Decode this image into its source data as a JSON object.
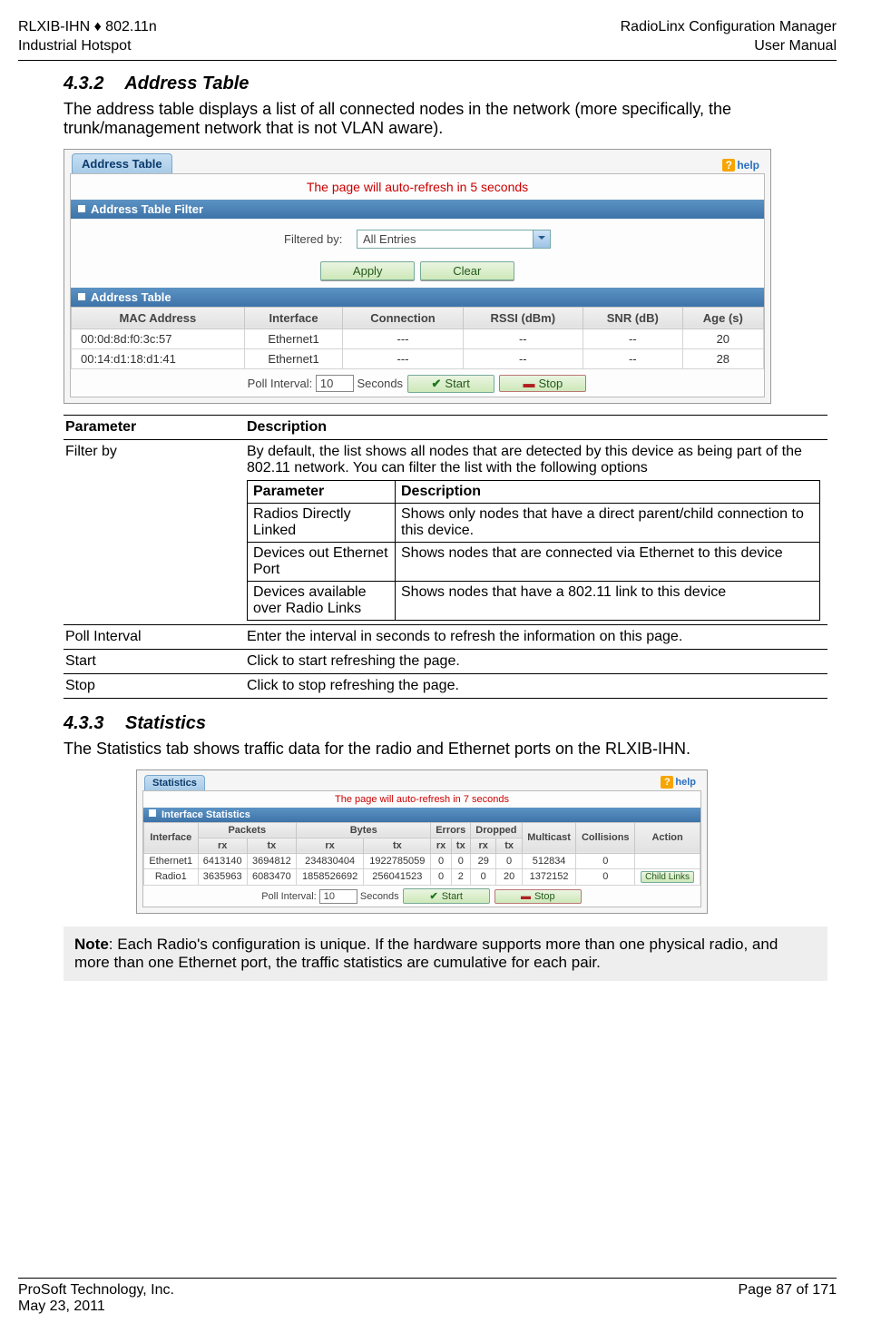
{
  "header": {
    "left_line1": "RLXIB-IHN ♦ 802.11n",
    "left_line2": "Industrial Hotspot",
    "right_line1": "RadioLinx Configuration Manager",
    "right_line2": "User Manual"
  },
  "sec1": {
    "num": "4.3.2",
    "title": "Address Table",
    "intro": "The address table displays a list of all connected nodes in the network (more specifically, the trunk/management network that is not VLAN aware)."
  },
  "addr_panel": {
    "tab": "Address Table",
    "help": "help",
    "refresh": "The page will auto-refresh in 5 seconds",
    "filter_bar": "Address Table Filter",
    "filtered_by": "Filtered by:",
    "dropdown_value": "All Entries",
    "apply": "Apply",
    "clear": "Clear",
    "table_bar": "Address Table",
    "cols": [
      "MAC Address",
      "Interface",
      "Connection",
      "RSSI (dBm)",
      "SNR (dB)",
      "Age (s)"
    ],
    "rows": [
      {
        "mac": "00:0d:8d:f0:3c:57",
        "iface": "Ethernet1",
        "conn": "---",
        "rssi": "--",
        "snr": "--",
        "age": "20"
      },
      {
        "mac": "00:14:d1:18:d1:41",
        "iface": "Ethernet1",
        "conn": "---",
        "rssi": "--",
        "snr": "--",
        "age": "28"
      }
    ],
    "poll_label": "Poll Interval:",
    "poll_value": "10",
    "seconds": "Seconds",
    "start": "Start",
    "stop": "Stop"
  },
  "param_table": {
    "hdrA": "Parameter",
    "hdrB": "Description",
    "rows": {
      "filter_by": {
        "name": "Filter by",
        "desc_intro": "By default, the list shows all nodes that are detected by this device as being part of the 802.11 network. You can filter the list with the following options",
        "inner_hdrA": "Parameter",
        "inner_hdrB": "Description",
        "inner": [
          {
            "p": "Radios Directly Linked",
            "d": "Shows only nodes that have a direct parent/child connection to this device."
          },
          {
            "p": "Devices out Ethernet Port",
            "d": "Shows nodes that are connected via Ethernet to this device"
          },
          {
            "p": "Devices available over Radio Links",
            "d": "Shows nodes that have a 802.11 link to this device"
          }
        ]
      },
      "poll": {
        "name": "Poll Interval",
        "desc": "Enter the interval in seconds to refresh the information on this page."
      },
      "start": {
        "name": "Start",
        "desc": "Click to start refreshing the page."
      },
      "stop": {
        "name": "Stop",
        "desc": "Click to stop refreshing the page."
      }
    }
  },
  "sec2": {
    "num": "4.3.3",
    "title": "Statistics",
    "intro": "The Statistics tab shows traffic data for the radio and Ethernet ports on the RLXIB-IHN."
  },
  "stats_panel": {
    "tab": "Statistics",
    "help": "help",
    "refresh": "The page will auto-refresh in 7 seconds",
    "bar": "Interface Statistics",
    "top_cols": [
      "Interface",
      "Packets",
      "Bytes",
      "Errors",
      "Dropped",
      "Multicast",
      "Collisions",
      "Action"
    ],
    "sub_cols": [
      "rx",
      "tx",
      "rx",
      "tx",
      "rx",
      "tx",
      "rx",
      "tx"
    ],
    "rows": [
      {
        "iface": "Ethernet1",
        "prx": "6413140",
        "ptx": "3694812",
        "brx": "234830404",
        "btx": "1922785059",
        "erx": "0",
        "etx": "0",
        "drx": "29",
        "dtx": "0",
        "mc": "512834",
        "col": "0",
        "action": ""
      },
      {
        "iface": "Radio1",
        "prx": "3635963",
        "ptx": "6083470",
        "brx": "1858526692",
        "btx": "256041523",
        "erx": "0",
        "etx": "2",
        "drx": "0",
        "dtx": "20",
        "mc": "1372152",
        "col": "0",
        "action": "Child Links"
      }
    ],
    "poll_label": "Poll Interval:",
    "poll_value": "10",
    "seconds": "Seconds",
    "start": "Start",
    "stop": "Stop"
  },
  "note": {
    "label": "Note",
    "text": ": Each Radio's configuration is unique. If the hardware supports more than one physical radio, and more than one Ethernet port, the traffic statistics are cumulative for each pair."
  },
  "footer": {
    "left_line1": "ProSoft Technology, Inc.",
    "left_line2": "May 23, 2011",
    "right": "Page 87 of 171"
  }
}
